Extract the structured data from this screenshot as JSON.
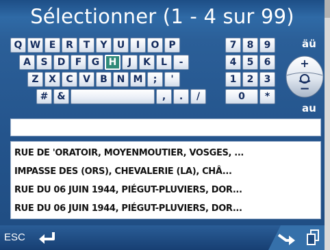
{
  "title": "Sélectionner (1 - 4 sur 99)",
  "keyboard": {
    "rows": [
      [
        "Q",
        "W",
        "E",
        "R",
        "T",
        "Y",
        "U",
        "I",
        "O",
        "P"
      ],
      [
        "A",
        "S",
        "D",
        "F",
        "G",
        "H",
        "J",
        "K",
        "L",
        "-"
      ],
      [
        "Z",
        "X",
        "C",
        "V",
        "B",
        "N",
        "M",
        ";",
        "'"
      ],
      [
        "#",
        "&",
        "",
        ",",
        ".",
        "/"
      ]
    ],
    "numpad": [
      [
        "7",
        "8",
        "9"
      ],
      [
        "4",
        "5",
        "6"
      ],
      [
        "1",
        "2",
        "3"
      ],
      [
        "0",
        "*"
      ]
    ],
    "selected_key": "H",
    "accent_top_label": "äü",
    "accent_bottom_label": "au"
  },
  "search": {
    "value": ""
  },
  "results": [
    "RUE DE 'ORATOIR, MOYENMOUTIER, VOSGES, ...",
    "IMPASSE DES (ORS), CHEVALERIE (LA), CHÂ...",
    "RUE DU 06 JUIN 1944, PIÉGUT-PLUVIERS, DOR...",
    "RUE DU 06 JUIN 1944, PIÉGUT-PLUVIERS, DOR..."
  ],
  "bottom": {
    "esc_label": "ESC"
  },
  "icons": {
    "back": "back-arrow-icon",
    "next": "next-arrow-icon",
    "copy": "copy-icon",
    "zoom": "zoom-control-icon"
  },
  "colors": {
    "background": "#2b5f98",
    "selected_key": "#2f8a78",
    "key_text": "#142c5e"
  }
}
